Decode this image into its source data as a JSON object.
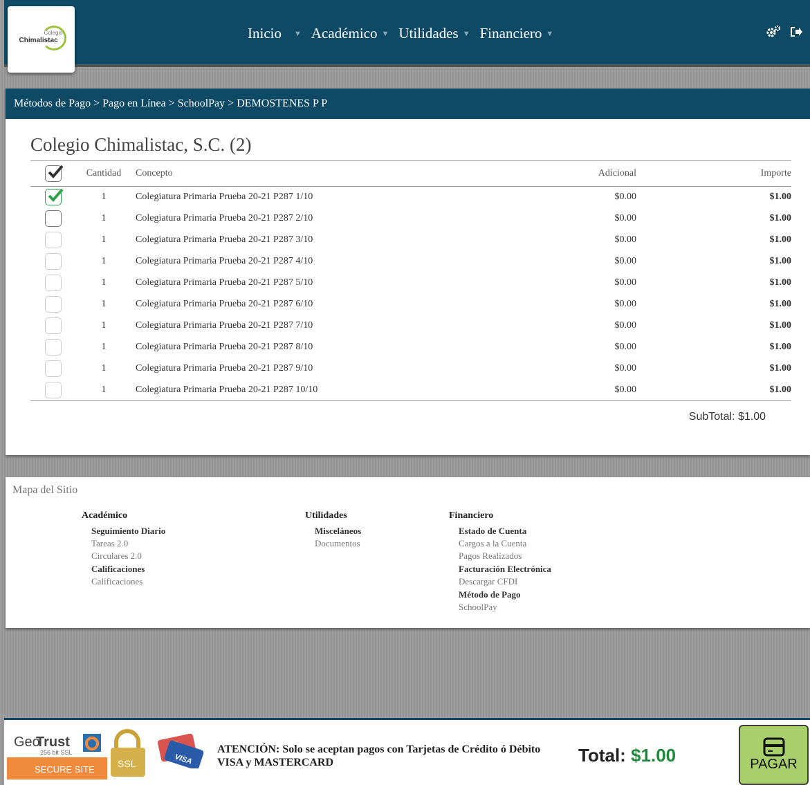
{
  "logo": {
    "small": "Colegio",
    "text": "Chimalistac"
  },
  "nav": {
    "items": [
      {
        "label": "Inicio"
      },
      {
        "label": "Académico"
      },
      {
        "label": "Utilidades"
      },
      {
        "label": "Financiero"
      }
    ]
  },
  "breadcrumb": [
    "Métodos de Pago",
    "Pago en Línea",
    "SchoolPay",
    "DEMOSTENES P P"
  ],
  "school_title": "Colegio Chimalistac, S.C. (2)",
  "table": {
    "headers": {
      "qty": "Cantidad",
      "concept": "Concepto",
      "additional": "Adicional",
      "amount": "Importe"
    },
    "rows": [
      {
        "checked": true,
        "enabled": true,
        "qty": "1",
        "concept": "Colegiatura Primaria Prueba 20-21 P287 1/10",
        "additional": "$0.00",
        "amount": "$1.00"
      },
      {
        "checked": false,
        "enabled": true,
        "qty": "1",
        "concept": "Colegiatura Primaria Prueba 20-21 P287 2/10",
        "additional": "$0.00",
        "amount": "$1.00"
      },
      {
        "checked": false,
        "enabled": false,
        "qty": "1",
        "concept": "Colegiatura Primaria Prueba 20-21 P287 3/10",
        "additional": "$0.00",
        "amount": "$1.00"
      },
      {
        "checked": false,
        "enabled": false,
        "qty": "1",
        "concept": "Colegiatura Primaria Prueba 20-21 P287 4/10",
        "additional": "$0.00",
        "amount": "$1.00"
      },
      {
        "checked": false,
        "enabled": false,
        "qty": "1",
        "concept": "Colegiatura Primaria Prueba 20-21 P287 5/10",
        "additional": "$0.00",
        "amount": "$1.00"
      },
      {
        "checked": false,
        "enabled": false,
        "qty": "1",
        "concept": "Colegiatura Primaria Prueba 20-21 P287 6/10",
        "additional": "$0.00",
        "amount": "$1.00"
      },
      {
        "checked": false,
        "enabled": false,
        "qty": "1",
        "concept": "Colegiatura Primaria Prueba 20-21 P287 7/10",
        "additional": "$0.00",
        "amount": "$1.00"
      },
      {
        "checked": false,
        "enabled": false,
        "qty": "1",
        "concept": "Colegiatura Primaria Prueba 20-21 P287 8/10",
        "additional": "$0.00",
        "amount": "$1.00"
      },
      {
        "checked": false,
        "enabled": false,
        "qty": "1",
        "concept": "Colegiatura Primaria Prueba 20-21 P287 9/10",
        "additional": "$0.00",
        "amount": "$1.00"
      },
      {
        "checked": false,
        "enabled": false,
        "qty": "1",
        "concept": "Colegiatura Primaria Prueba 20-21 P287 10/10",
        "additional": "$0.00",
        "amount": "$1.00"
      }
    ]
  },
  "subtotal": "SubTotal: $1.00",
  "sitemap": {
    "title": "Mapa del Sitio",
    "academico": {
      "head": "Académico",
      "sub1": "Seguimiento Diario",
      "link1": "Tareas 2.0",
      "link2": "Circulares 2.0",
      "sub2": "Calificaciones",
      "link3": "Calificaciones"
    },
    "utilidades": {
      "head": "Utilidades",
      "sub1": "Misceláneos",
      "link1": "Documentos"
    },
    "financiero": {
      "head": "Financiero",
      "sub1": "Estado de Cuenta",
      "link1": "Cargos a la Cuenta",
      "link2": "Pagos Realizados",
      "sub2": "Facturación Electrónica",
      "link3": "Descargar CFDI",
      "sub3": "Método de Pago",
      "link4": "SchoolPay"
    }
  },
  "footer": {
    "geotrust": {
      "brand_a": "Geo",
      "brand_b": "Trust",
      "ssl": "256 bit SSL",
      "secure": "SECURE SITE",
      "lock_text": "SSL"
    },
    "cards_text": "VISA",
    "atencion": "ATENCIÓN: Solo se aceptan pagos con Tarjetas de Crédito ó Débito VISA y MASTERCARD",
    "total_label": "Total:",
    "total_value": "$1.00",
    "pay_label": "PAGAR"
  },
  "colors": {
    "navy": "#0e4a66",
    "check_green": "#2ca04a",
    "pay_green": "#a8cf6a",
    "total_green": "#1f8a3c"
  }
}
